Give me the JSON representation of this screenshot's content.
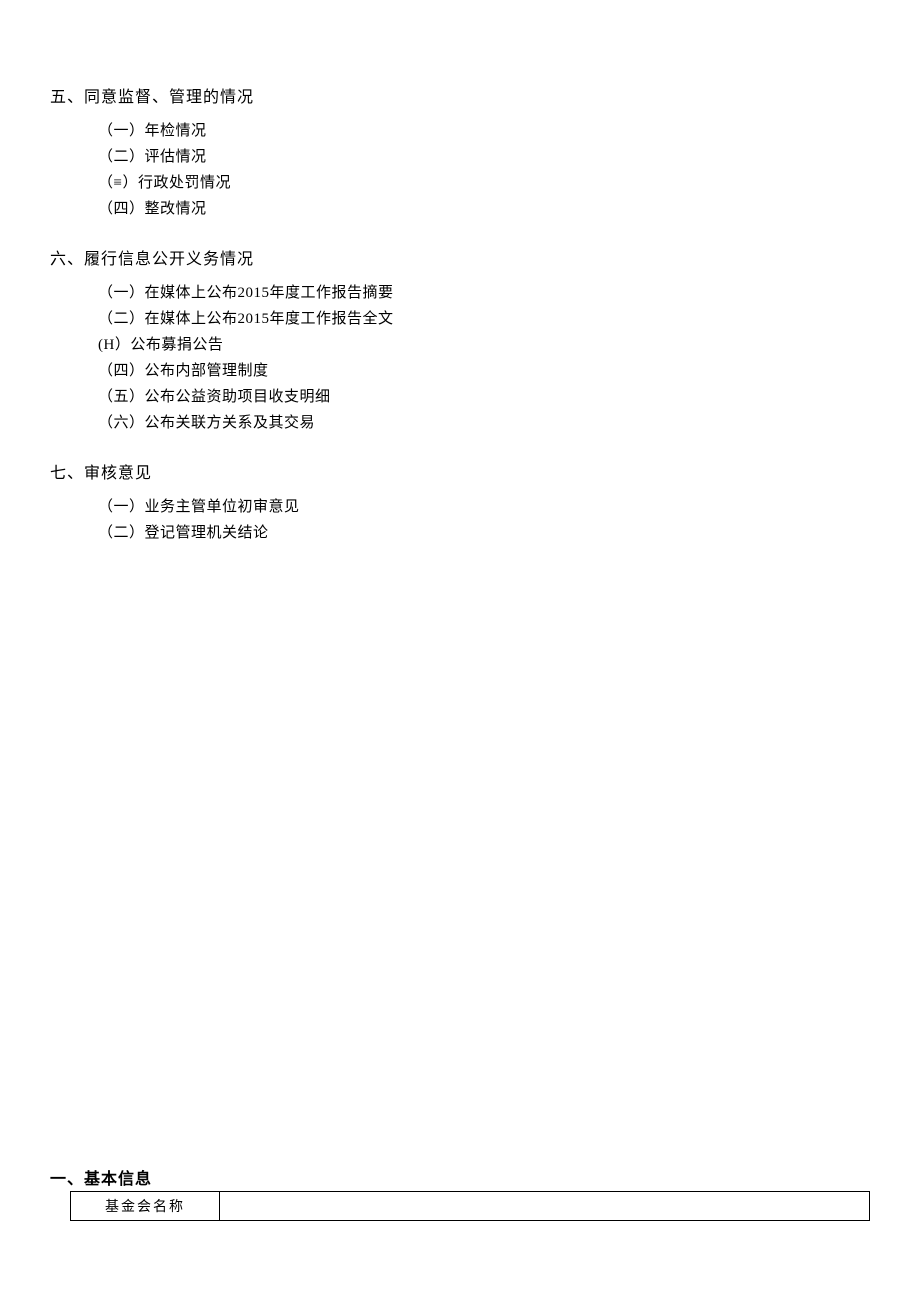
{
  "section5": {
    "title": "五、同意监督、管理的情况",
    "items": [
      "（一）年检情况",
      "（二）评估情况",
      "（≡）行政处罚情况",
      "（四）整改情况"
    ]
  },
  "section6": {
    "title": "六、履行信息公开义务情况",
    "items": [
      "（一）在媒体上公布2015年度工作报告摘要",
      "（二）在媒体上公布2015年度工作报告全文",
      "(H）公布募捐公告",
      "（四）公布内部管理制度",
      "（五）公布公益资助项目收支明细",
      "（六）公布关联方关系及其交易"
    ]
  },
  "section7": {
    "title": "七、审核意见",
    "items": [
      "（一）业务主管单位初审意见",
      "（二）登记管理机关结论"
    ]
  },
  "basicInfo": {
    "title": "一、基本信息",
    "row1Label": "基金会名称",
    "row1Value": ""
  }
}
